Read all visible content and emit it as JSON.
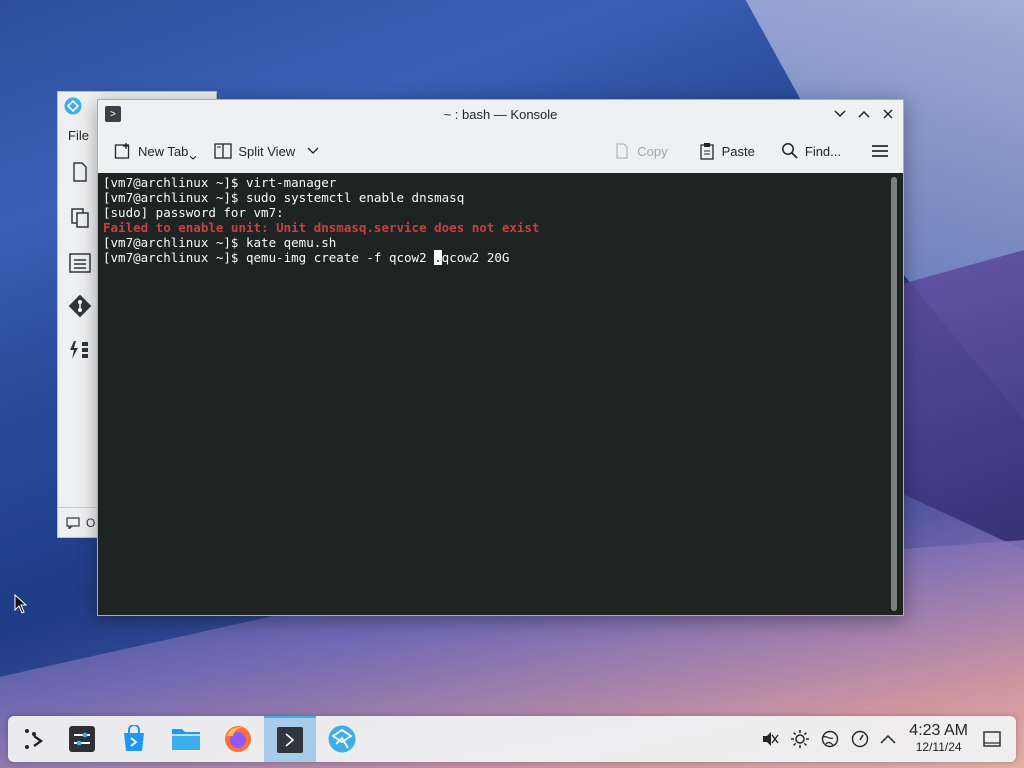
{
  "background_window": {
    "menu_file": "File",
    "status_text": "O"
  },
  "konsole": {
    "title": "~ : bash — Konsole",
    "toolbar": {
      "new_tab": "New Tab",
      "split_view": "Split View",
      "copy": "Copy",
      "paste": "Paste",
      "find": "Find..."
    },
    "terminal_lines": [
      "[vm7@archlinux ~]$ virt-manager",
      "[vm7@archlinux ~]$ sudo systemctl enable dnsmasq",
      "[sudo] password for vm7:",
      "Failed to enable unit: Unit dnsmasq.service does not exist",
      "[vm7@archlinux ~]$ kate qemu.sh"
    ],
    "current_line_before_cursor": "[vm7@archlinux ~]$ qemu-img create -f qcow2 ",
    "cursor_char": ".",
    "current_line_after_cursor": "qcow2 20G"
  },
  "taskbar": {
    "clock_time": "4:23 AM",
    "clock_date": "12/11/24"
  },
  "colors": {
    "terminal_bg": "#1f2423",
    "error_text": "#c64142",
    "accent": "#3daee9"
  }
}
